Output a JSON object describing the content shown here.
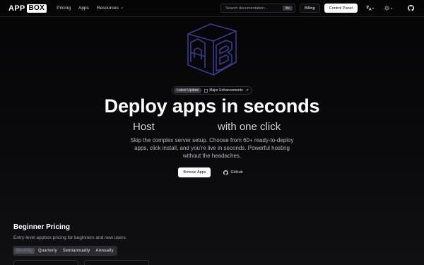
{
  "nav": {
    "logo_part1": "APP",
    "logo_part2": "BOX",
    "links": [
      "Pricing",
      "Apps",
      "Resources"
    ],
    "resources_caret": "⌄",
    "search_placeholder": "Search documentation...",
    "search_shortcut": "⌘K",
    "billing": "Billing",
    "control_panel": "Control Panel",
    "translate_icon": "translate-icon",
    "theme_icon": "theme-icon",
    "github_icon": "github-icon"
  },
  "hero": {
    "badge_label": "Latest Update",
    "badge_text": "Major Enhancements",
    "badge_arrow": "↗",
    "title": "Deploy apps in seconds",
    "subtitle_part1": "Host",
    "subtitle_part2": "with one click",
    "description": "Skip the complex server setup. Choose from 60+ ready-to-deploy apps, click install, and you're live in seconds. Powerful hosting without the headaches.",
    "primary_cta": "Browse Apps",
    "secondary_cta": "GitHub"
  },
  "pricing": {
    "title": "Beginner Pricing",
    "description": "Entry-level appbox pricing for beginners and new users.",
    "tabs": [
      "Monthly",
      "Quarterly",
      "Semiannually",
      "Annually"
    ],
    "active_tab": "Monthly"
  },
  "colors": {
    "background": "#050506",
    "accent_logo": "#3b3a8f",
    "text_primary": "#ffffff"
  }
}
